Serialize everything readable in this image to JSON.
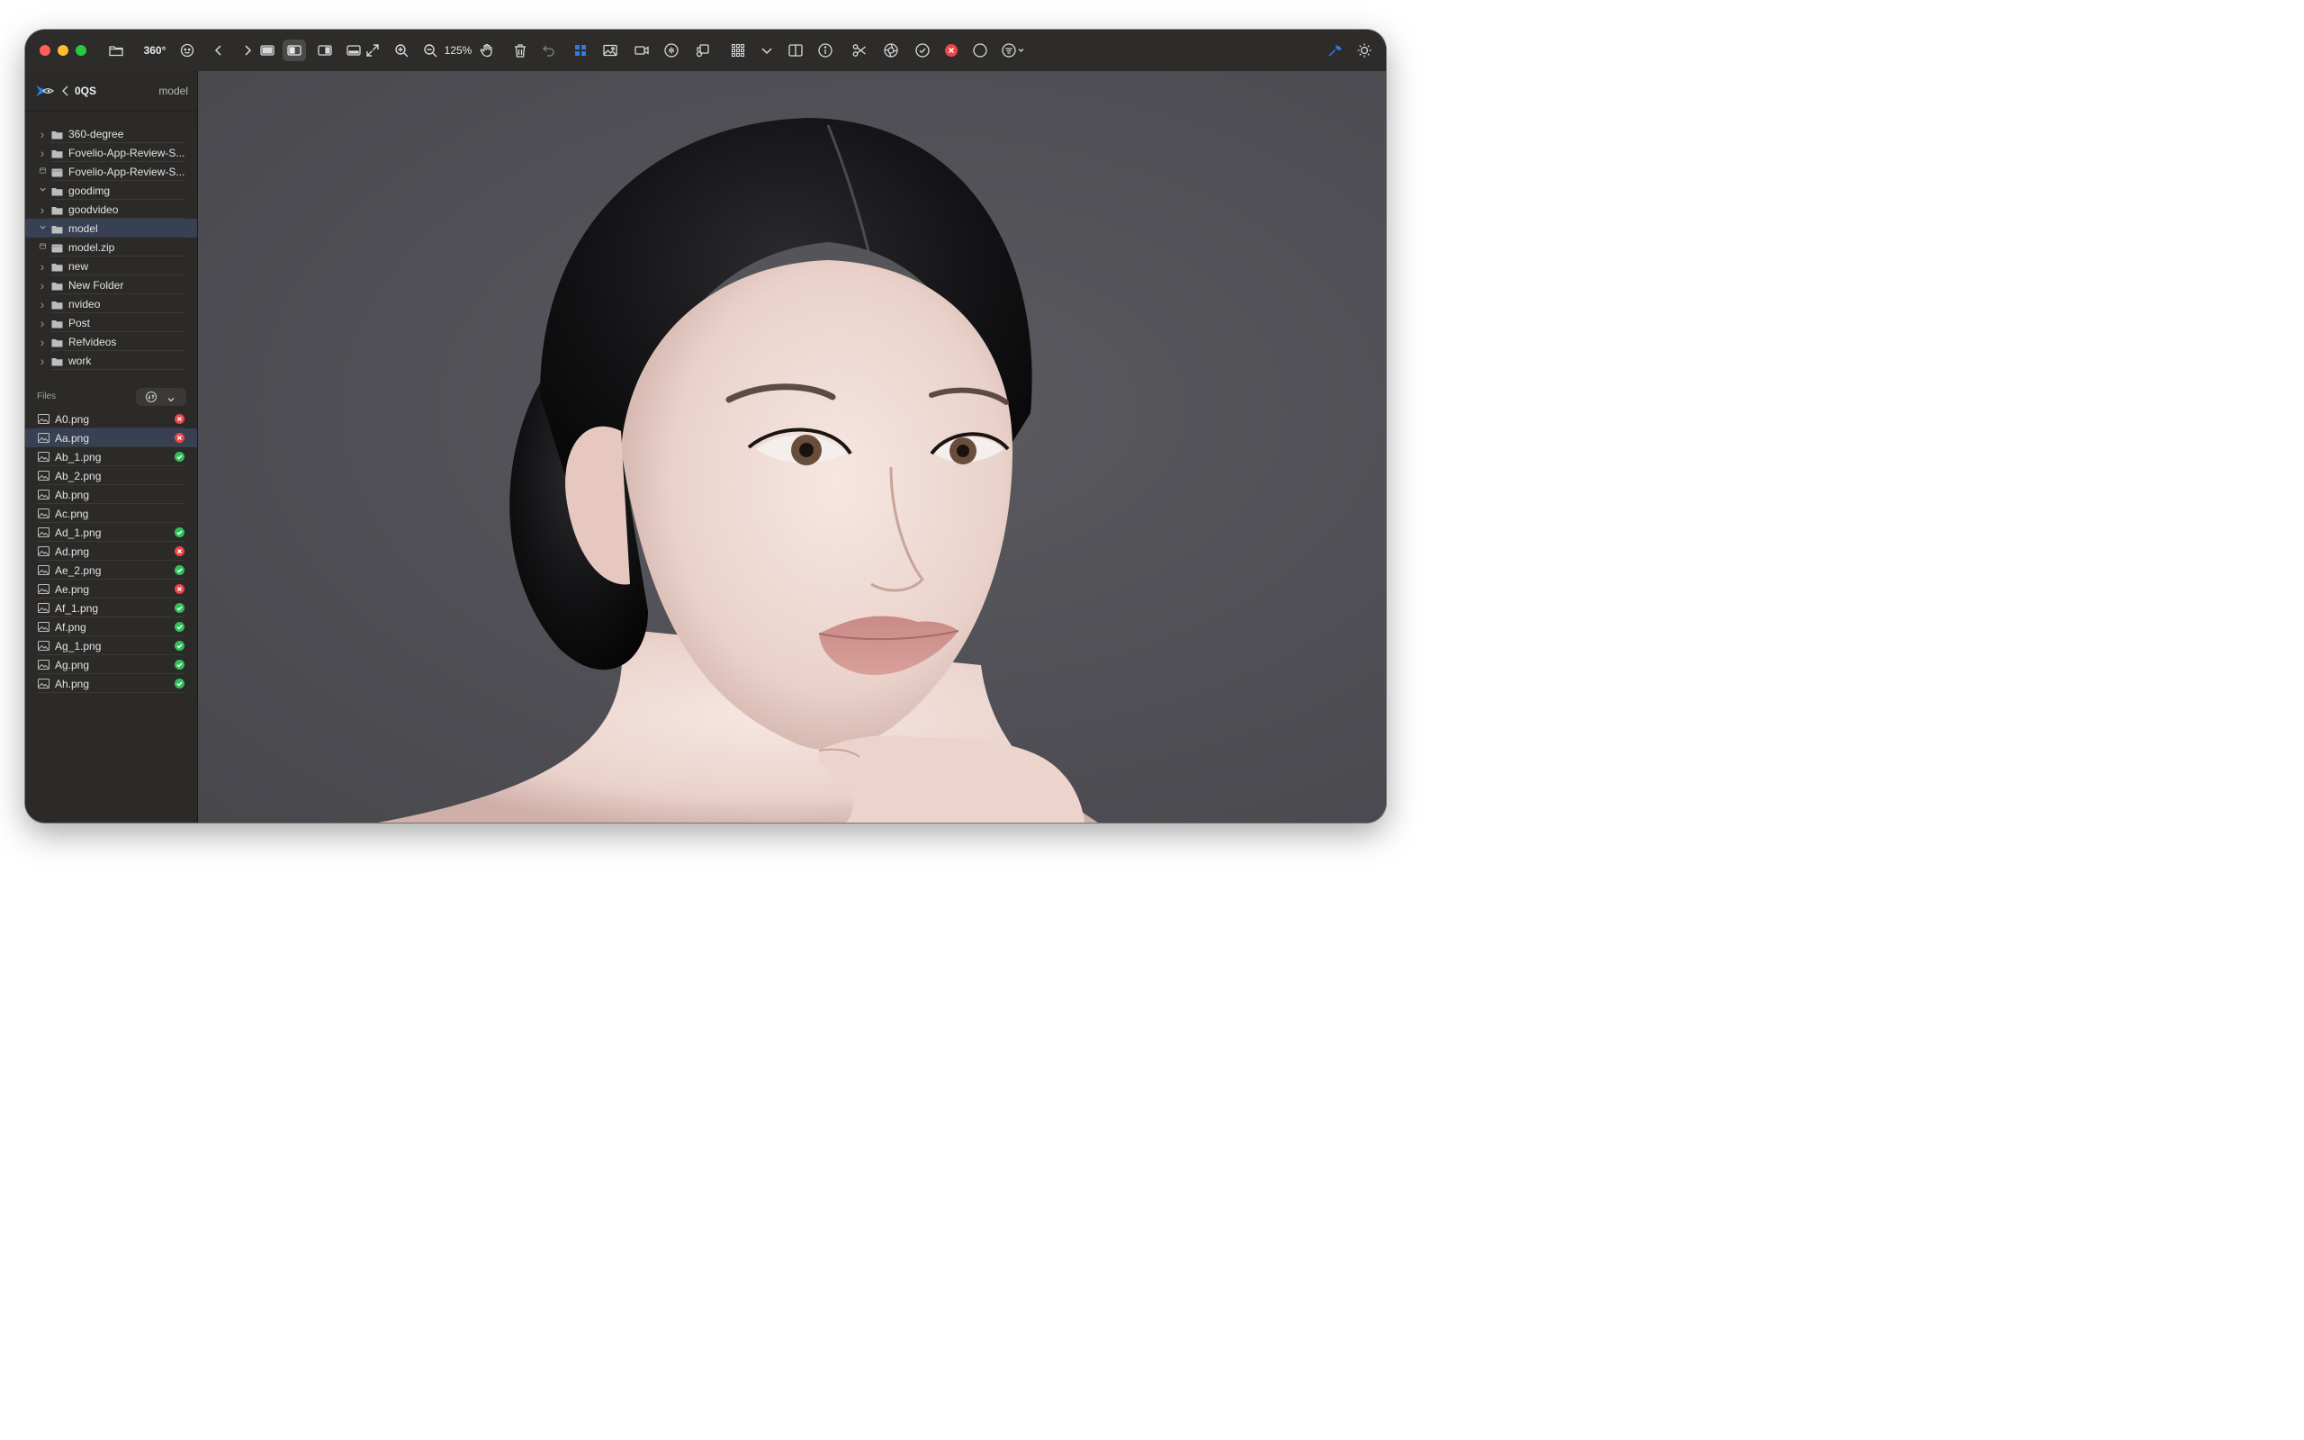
{
  "toolbar": {
    "view_mode": "360°",
    "zoom": "125%"
  },
  "colors": {
    "close": "#ff5f57",
    "minimize": "#febc2e",
    "zoom": "#28c840",
    "accent": "#2f7be5",
    "selection": "#374153",
    "status_ok": "#30c15a",
    "status_rejected": "#ef4545"
  },
  "sidebar": {
    "app_name": "0QS",
    "current_folder": "model",
    "folders": [
      {
        "name": "360-degree",
        "type": "folder",
        "expand": "collapsed"
      },
      {
        "name": "Fovelio-App-Review-S...",
        "type": "folder",
        "expand": "collapsed"
      },
      {
        "name": "Fovelio-App-Review-S...",
        "type": "archive",
        "expand": "none"
      },
      {
        "name": "goodimg",
        "type": "folder",
        "expand": "expanded"
      },
      {
        "name": "goodvideo",
        "type": "folder",
        "expand": "collapsed"
      },
      {
        "name": "model",
        "type": "folder",
        "expand": "expanded",
        "selected": true
      },
      {
        "name": "model.zip",
        "type": "archive",
        "expand": "none"
      },
      {
        "name": "new",
        "type": "folder",
        "expand": "collapsed"
      },
      {
        "name": "New Folder",
        "type": "folder",
        "expand": "collapsed"
      },
      {
        "name": "nvideo",
        "type": "folder",
        "expand": "collapsed"
      },
      {
        "name": "Post",
        "type": "folder",
        "expand": "collapsed"
      },
      {
        "name": "Refvideos",
        "type": "folder",
        "expand": "collapsed"
      },
      {
        "name": "work",
        "type": "folder",
        "expand": "collapsed"
      }
    ],
    "files_label": "Files",
    "files": [
      {
        "name": "A0.png",
        "status": "rejected"
      },
      {
        "name": "Aa.png",
        "status": "rejected",
        "selected": true
      },
      {
        "name": "Ab_1.png",
        "status": "ok"
      },
      {
        "name": "Ab_2.png",
        "status": "none"
      },
      {
        "name": "Ab.png",
        "status": "none"
      },
      {
        "name": "Ac.png",
        "status": "none"
      },
      {
        "name": "Ad_1.png",
        "status": "ok"
      },
      {
        "name": "Ad.png",
        "status": "rejected"
      },
      {
        "name": "Ae_2.png",
        "status": "ok"
      },
      {
        "name": "Ae.png",
        "status": "rejected"
      },
      {
        "name": "Af_1.png",
        "status": "ok"
      },
      {
        "name": "Af.png",
        "status": "ok"
      },
      {
        "name": "Ag_1.png",
        "status": "ok"
      },
      {
        "name": "Ag.png",
        "status": "ok"
      },
      {
        "name": "Ah.png",
        "status": "ok"
      }
    ]
  }
}
